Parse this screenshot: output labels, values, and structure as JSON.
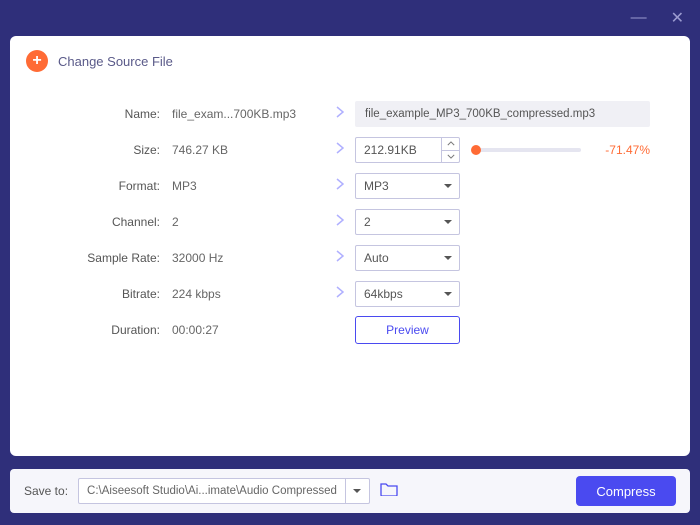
{
  "titlebar": {
    "minimize": "—",
    "close": "✕"
  },
  "header": {
    "title": "Change Source File"
  },
  "rows": {
    "name": {
      "label": "Name:",
      "src": "file_exam...700KB.mp3",
      "dest": "file_example_MP3_700KB_compressed.mp3"
    },
    "size": {
      "label": "Size:",
      "src": "746.27 KB",
      "dest": "212.91KB",
      "pct": "-71.47%"
    },
    "format": {
      "label": "Format:",
      "src": "MP3",
      "dest": "MP3"
    },
    "channel": {
      "label": "Channel:",
      "src": "2",
      "dest": "2"
    },
    "samplerate": {
      "label": "Sample Rate:",
      "src": "32000 Hz",
      "dest": "Auto"
    },
    "bitrate": {
      "label": "Bitrate:",
      "src": "224 kbps",
      "dest": "64kbps"
    },
    "duration": {
      "label": "Duration:",
      "src": "00:00:27",
      "action": "Preview"
    }
  },
  "footer": {
    "label": "Save to:",
    "path": "C:\\Aiseesoft Studio\\Ai...imate\\Audio Compressed",
    "compress": "Compress"
  }
}
